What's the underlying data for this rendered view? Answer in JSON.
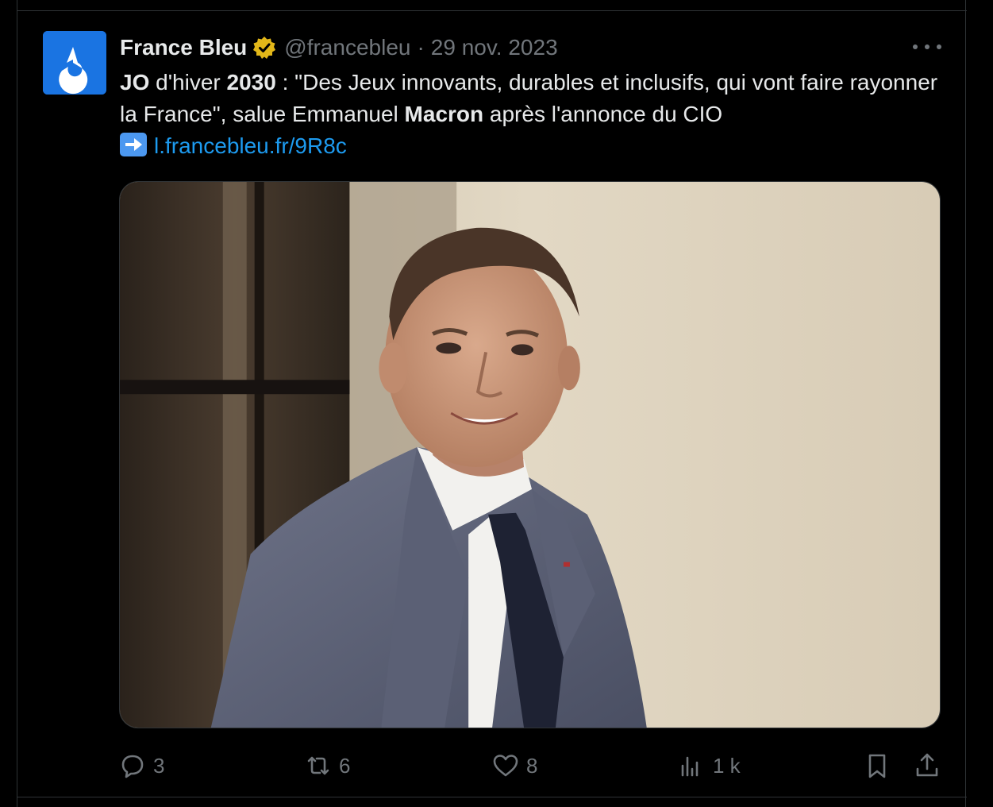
{
  "tweet": {
    "author_name": "France Bleu",
    "handle": "@francebleu",
    "separator": "·",
    "date": "29 nov. 2023",
    "text_parts": {
      "p1": "JO",
      "p2": " d'hiver ",
      "p3": "2030",
      "p4": " : \"Des Jeux innovants, durables et inclusifs, qui vont faire rayonner la France\", salue Emmanuel ",
      "p5": "Macron",
      "p6": " après l'annonce du CIO"
    },
    "link": "l.francebleu.fr/9R8c"
  },
  "actions": {
    "replies": "3",
    "reposts": "6",
    "likes": "8",
    "views": "1 k"
  },
  "colors": {
    "background": "#000000",
    "text": "#e7e9ea",
    "muted": "#71767b",
    "link": "#1d9bf0",
    "verified_badge": "#e2b719",
    "avatar_bg": "#1a74e2"
  },
  "icons": {
    "avatar": "france-bleu-logo",
    "badge": "verified-gold-badge",
    "more": "more-dots-icon",
    "arrow": "right-arrow-emoji",
    "reply": "reply-icon",
    "repost": "repost-icon",
    "like": "heart-icon",
    "views": "views-icon",
    "bookmark": "bookmark-icon",
    "share": "share-icon"
  }
}
